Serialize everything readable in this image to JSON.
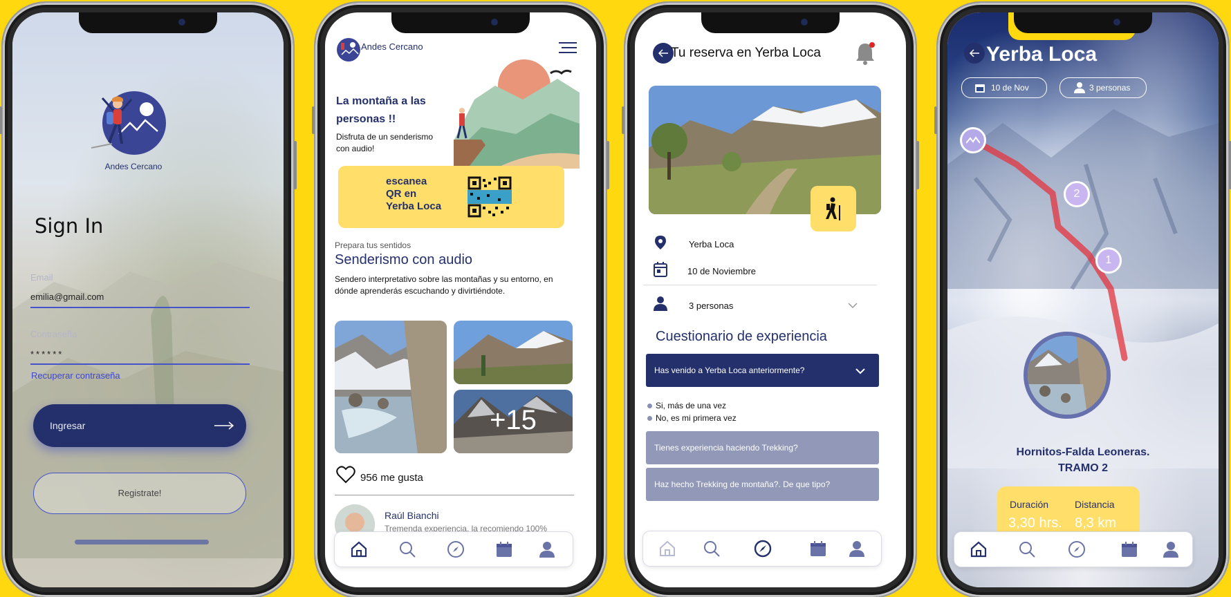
{
  "colors": {
    "background": "#FFD80F",
    "primary": "#24306B",
    "accent_yellow": "#FFDE6A",
    "link": "#3D46D6",
    "muted_question": "#9198B8"
  },
  "signin": {
    "brand": "Andes Cercano",
    "title": "Sign In",
    "email_label": "Email",
    "email_value": "emilia@gmail.com",
    "password_label": "Contraseña",
    "password_value": "******",
    "recover_link": "Recuperar contraseña",
    "login_button": "Ingresar",
    "register_button": "Registrate!"
  },
  "home": {
    "brand": "Andes Cercano",
    "hero_title": "La montaña a las personas !!",
    "hero_subtitle": "Disfruta de un senderismo con audio!",
    "qr_text_line1": "escanea",
    "qr_text_line2": "QR en",
    "qr_text_line3": "Yerba Loca",
    "section_kicker": "Prepara tus sentidos",
    "section_title": "Senderismo con audio",
    "section_desc": "Sendero interpretativo sobre las montañas y su entorno, en dónde aprenderás escuchando y divirtiéndote.",
    "more_photos": "+15",
    "likes": "956 me gusta",
    "comment_user": "Raúl  Bianchi",
    "comment_text": "Tremenda experiencia, la recomiendo 100%"
  },
  "reservation": {
    "title": "Tu reserva en Yerba Loca",
    "location": "Yerba Loca",
    "date": "10  de Noviembre",
    "people": "3 personas",
    "questionnaire_title": "Cuestionario de experiencia",
    "q1": "Has venido a Yerba Loca anteriormente?",
    "q1_options": [
      "Si,  más de una vez",
      "No, es mi primera vez"
    ],
    "q2": "Tienes experiencia haciendo Trekking?",
    "q3": "Haz hecho Trekking de montaña?. De que tipo?"
  },
  "route": {
    "title": "Yerba Loca",
    "date_chip": "10 de Nov",
    "people_chip": "3 personas",
    "pin_2": "2",
    "pin_1": "1",
    "segment_title": "Hornitos-Falda Leoneras.",
    "segment_subtitle": "TRAMO 2",
    "duration_label": "Duración",
    "duration_value": "3,30 hrs.",
    "distance_label": "Distancia",
    "distance_value": "8,3 km"
  },
  "nav_icons": [
    "home-icon",
    "search-icon",
    "compass-icon",
    "calendar-icon",
    "profile-icon"
  ]
}
